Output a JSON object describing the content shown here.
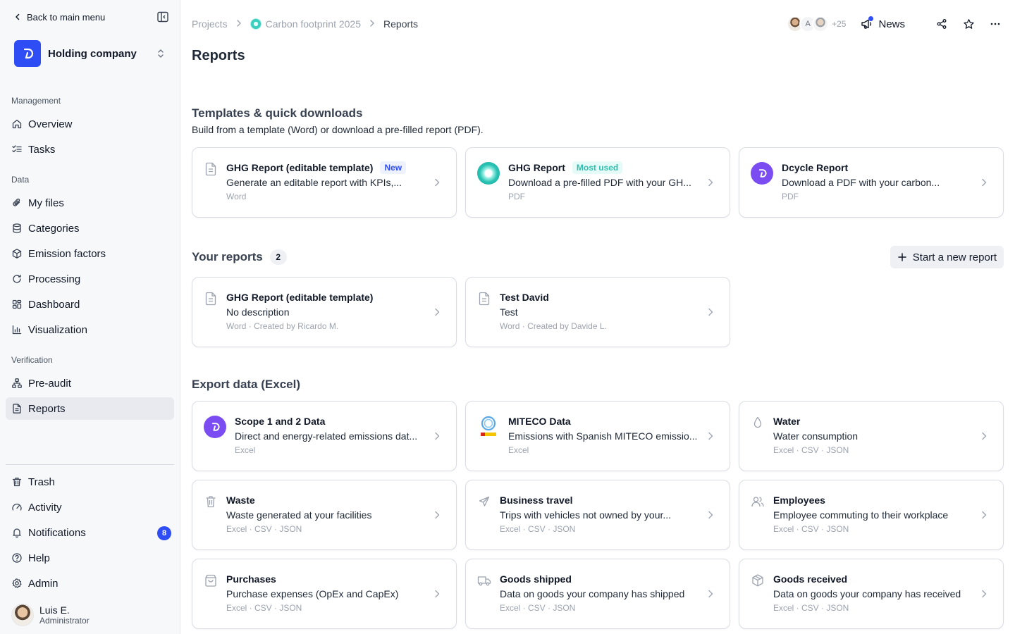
{
  "sidebar": {
    "back_label": "Back to main menu",
    "org_name": "Holding company",
    "sections": {
      "management": "Management",
      "data": "Data",
      "verification": "Verification"
    },
    "items": {
      "overview": "Overview",
      "tasks": "Tasks",
      "my_files": "My files",
      "categories": "Categories",
      "emission_factors": "Emission factors",
      "processing": "Processing",
      "dashboard": "Dashboard",
      "visualization": "Visualization",
      "pre_audit": "Pre-audit",
      "reports": "Reports",
      "trash": "Trash",
      "activity": "Activity",
      "notifications": "Notifications",
      "help": "Help",
      "admin": "Admin"
    },
    "notifications_count": "8",
    "user": {
      "name": "Luis E.",
      "role": "Administrator"
    }
  },
  "header": {
    "breadcrumb": [
      "Projects",
      "Carbon footprint 2025",
      "Reports"
    ],
    "avatars_more": "+25",
    "avatar_initial": "A",
    "news_label": "News",
    "title": "Reports"
  },
  "templates": {
    "title": "Templates & quick downloads",
    "subtitle": "Build from a template (Word) or download a pre-filled report (PDF).",
    "cards": [
      {
        "title": "GHG Report (editable template)",
        "tag": "New",
        "desc": "Generate an editable report with KPIs,...",
        "meta": "Word"
      },
      {
        "title": "GHG Report",
        "tag": "Most used",
        "desc": "Download a pre-filled PDF with your GH...",
        "meta": "PDF"
      },
      {
        "title": "Dcycle Report",
        "desc": "Download a PDF with your carbon...",
        "meta": "PDF"
      }
    ]
  },
  "your_reports": {
    "title": "Your reports",
    "count": "2",
    "new_button": "Start a new report",
    "cards": [
      {
        "title": "GHG Report (editable template)",
        "desc": "No description",
        "meta": "Word · Created by Ricardo M."
      },
      {
        "title": "Test David",
        "desc": "Test",
        "meta": "Word · Created by Davide L."
      }
    ]
  },
  "export": {
    "title": "Export data (Excel)",
    "cards": [
      {
        "title": "Scope 1 and 2 Data",
        "desc": "Direct and energy-related emissions dat...",
        "meta": "Excel",
        "icon": "dcycle-logo"
      },
      {
        "title": "MITECO Data",
        "desc": "Emissions with Spanish MITECO emissio...",
        "meta": "Excel",
        "icon": "miteco-logo"
      },
      {
        "title": "Water",
        "desc": "Water consumption",
        "meta": "Excel · CSV · JSON",
        "icon": "droplet-icon"
      },
      {
        "title": "Waste",
        "desc": "Waste generated at your facilities",
        "meta": "Excel · CSV · JSON",
        "icon": "trash-icon"
      },
      {
        "title": "Business travel",
        "desc": "Trips with vehicles not owned by your...",
        "meta": "Excel · CSV · JSON",
        "icon": "plane-icon"
      },
      {
        "title": "Employees",
        "desc": "Employee commuting to their workplace",
        "meta": "Excel · CSV · JSON",
        "icon": "users-icon"
      },
      {
        "title": "Purchases",
        "desc": "Purchase expenses (OpEx and CapEx)",
        "meta": "Excel · CSV · JSON",
        "icon": "shopping-bag-icon"
      },
      {
        "title": "Goods shipped",
        "desc": "Data on goods your company has shipped",
        "meta": "Excel · CSV · JSON",
        "icon": "truck-icon"
      },
      {
        "title": "Goods received",
        "desc": "Data on goods your company has received",
        "meta": "Excel · CSV · JSON",
        "icon": "package-icon"
      }
    ]
  },
  "colors": {
    "accent": "#2f4df5",
    "dcycle": "#7a4cf2",
    "teal": "#2fbfae"
  }
}
